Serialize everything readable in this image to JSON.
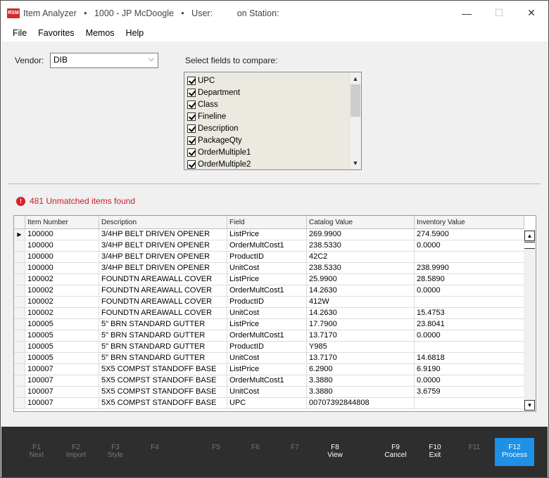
{
  "window": {
    "title": "Item Analyzer   •   1000 - JP McDoogle   •   User:          on Station:",
    "logo_text": "RSM",
    "minimize": "—",
    "maximize": "☐",
    "close": "✕"
  },
  "menu": [
    "File",
    "Favorites",
    "Memos",
    "Help"
  ],
  "vendor": {
    "label": "Vendor:",
    "value": "DIB"
  },
  "fields": {
    "label": "Select fields to compare:",
    "items": [
      "UPC",
      "Department",
      "Class",
      "Fineline",
      "Description",
      "PackageQty",
      "OrderMultiple1",
      "OrderMultiple2"
    ]
  },
  "status": {
    "icon": "!",
    "text": "481 Unmatched items found",
    "color": "#c8202a"
  },
  "grid": {
    "columns": [
      "Item Number",
      "Description",
      "Field",
      "Catalog Value",
      "Inventory Value"
    ],
    "rows": [
      [
        "100000",
        "3/4HP BELT DRIVEN OPENER",
        "ListPrice",
        "269.9900",
        "274.5900"
      ],
      [
        "100000",
        "3/4HP BELT DRIVEN OPENER",
        "OrderMultCost1",
        "238.5330",
        "0.0000"
      ],
      [
        "100000",
        "3/4HP BELT DRIVEN OPENER",
        "ProductID",
        "42C2",
        ""
      ],
      [
        "100000",
        "3/4HP BELT DRIVEN OPENER",
        "UnitCost",
        "238.5330",
        "238.9990"
      ],
      [
        "100002",
        "FOUNDTN AREAWALL COVER",
        "ListPrice",
        "25.9900",
        "28.5890"
      ],
      [
        "100002",
        "FOUNDTN AREAWALL COVER",
        "OrderMultCost1",
        "14.2630",
        "0.0000"
      ],
      [
        "100002",
        "FOUNDTN AREAWALL COVER",
        "ProductID",
        "412W",
        ""
      ],
      [
        "100002",
        "FOUNDTN AREAWALL COVER",
        "UnitCost",
        "14.2630",
        "15.4753"
      ],
      [
        "100005",
        "5\" BRN STANDARD GUTTER",
        "ListPrice",
        "17.7900",
        "23.8041"
      ],
      [
        "100005",
        "5\" BRN STANDARD GUTTER",
        "OrderMultCost1",
        "13.7170",
        "0.0000"
      ],
      [
        "100005",
        "5\" BRN STANDARD GUTTER",
        "ProductID",
        "Y985",
        ""
      ],
      [
        "100005",
        "5\" BRN STANDARD GUTTER",
        "UnitCost",
        "13.7170",
        "14.6818"
      ],
      [
        "100007",
        "5X5 COMPST STANDOFF BASE",
        "ListPrice",
        "6.2900",
        "6.9190"
      ],
      [
        "100007",
        "5X5 COMPST STANDOFF BASE",
        "OrderMultCost1",
        "3.3880",
        "0.0000"
      ],
      [
        "100007",
        "5X5 COMPST STANDOFF BASE",
        "UnitCost",
        "3.3880",
        "3.6759"
      ],
      [
        "100007",
        "5X5 COMPST STANDOFF BASE",
        "UPC",
        "00707392844808",
        ""
      ]
    ]
  },
  "fkeys": [
    {
      "key": "F1",
      "label": "Next",
      "state": "dim"
    },
    {
      "key": "F2",
      "label": "Import",
      "state": "dim"
    },
    {
      "key": "F3",
      "label": "Style",
      "state": "dim"
    },
    {
      "key": "F4",
      "label": "",
      "state": "dim"
    },
    {
      "key": "F5",
      "label": "",
      "state": "dim"
    },
    {
      "key": "F6",
      "label": "",
      "state": "dim"
    },
    {
      "key": "F7",
      "label": "",
      "state": "dim"
    },
    {
      "key": "F8",
      "label": "View",
      "state": "bright"
    },
    {
      "key": "F9",
      "label": "Cancel",
      "state": "bright"
    },
    {
      "key": "F10",
      "label": "Exit",
      "state": "bright"
    },
    {
      "key": "F11",
      "label": "",
      "state": "dim"
    },
    {
      "key": "F12",
      "label": "Process",
      "state": "primary"
    }
  ]
}
